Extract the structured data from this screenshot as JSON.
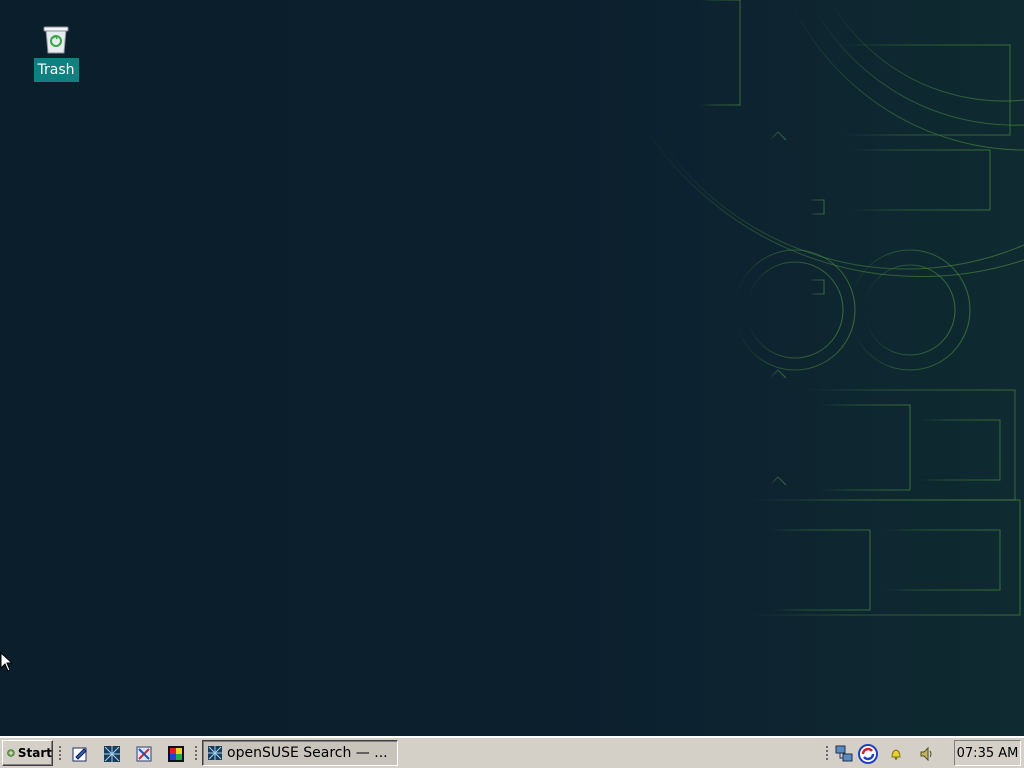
{
  "desktop": {
    "icons": [
      {
        "label": "Trash",
        "icon": "trash-icon"
      }
    ]
  },
  "taskbar": {
    "start_label": "Start",
    "quick_launch": [
      {
        "icon": "edit-document-icon"
      },
      {
        "icon": "network-blueprint-icon"
      },
      {
        "icon": "pencil-tool-icon"
      },
      {
        "icon": "color-palette-icon"
      }
    ],
    "tasks": [
      {
        "label": "openSUSE Search — ...",
        "icon": "browser-window-icon"
      }
    ],
    "tray": [
      {
        "icon": "network-icon"
      },
      {
        "icon": "update-sync-icon"
      },
      {
        "icon": "notification-bell-icon"
      },
      {
        "icon": "volume-icon"
      }
    ],
    "clock": "07:35 AM"
  },
  "colors": {
    "desktop_bg": "#0b1f2d",
    "icon_label_bg": "#118080",
    "taskbar_bg": "#d4d0c8"
  }
}
